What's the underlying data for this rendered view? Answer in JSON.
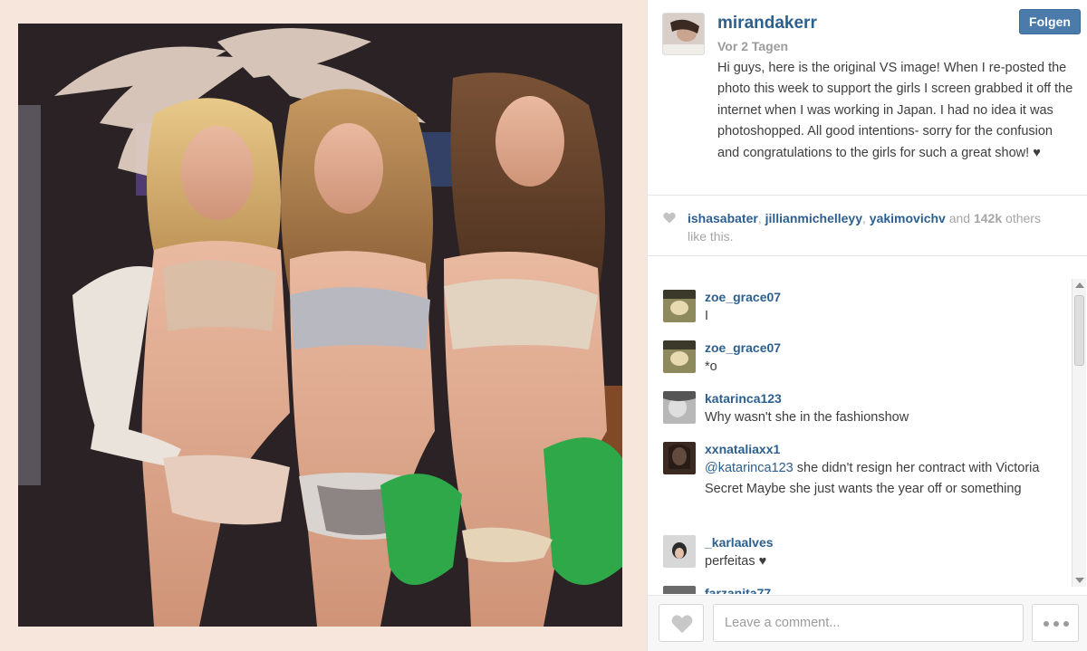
{
  "post": {
    "username": "mirandakerr",
    "follow_label": "Folgen",
    "time_ago": "Vor 2 Tagen",
    "caption": "Hi guys, here is the original VS image! When I re-posted the photo this week to support the girls I screen grabbed it off the internet when I was working in Japan. I had no idea it was photoshopped. All good intentions- sorry for the confusion and congratulations to the girls for such a great show! ♥"
  },
  "likes": {
    "user1": "ishasabater",
    "sep1": ", ",
    "user2": "jillianmichelleyy",
    "sep2": ", ",
    "user3": "yakimovichv",
    "and_text": " and ",
    "count": "142k",
    "suffix": " others like this."
  },
  "comments": [
    {
      "user": "zoe_grace07",
      "text": "I"
    },
    {
      "user": "zoe_grace07",
      "text": "*o"
    },
    {
      "user": "katarinca123",
      "text": "Why wasn't she in the fashionshow"
    },
    {
      "user": "xxnataliaxx1",
      "mention": "@katarinca123",
      "text": " she didn't resign her contract with Victoria Secret Maybe she just wants the year off or something"
    },
    {
      "user": "_karlaalves",
      "text": "perfeitas ♥"
    },
    {
      "user": "farzanita77",
      "text": ""
    }
  ],
  "footer": {
    "comment_placeholder": "Leave a comment..."
  },
  "icons": {
    "heart": "heart-icon",
    "more": "more-dots-icon"
  },
  "colors": {
    "link": "#2d5f8e",
    "follow_button": "#4a7bab",
    "muted": "#9b9b9b"
  }
}
